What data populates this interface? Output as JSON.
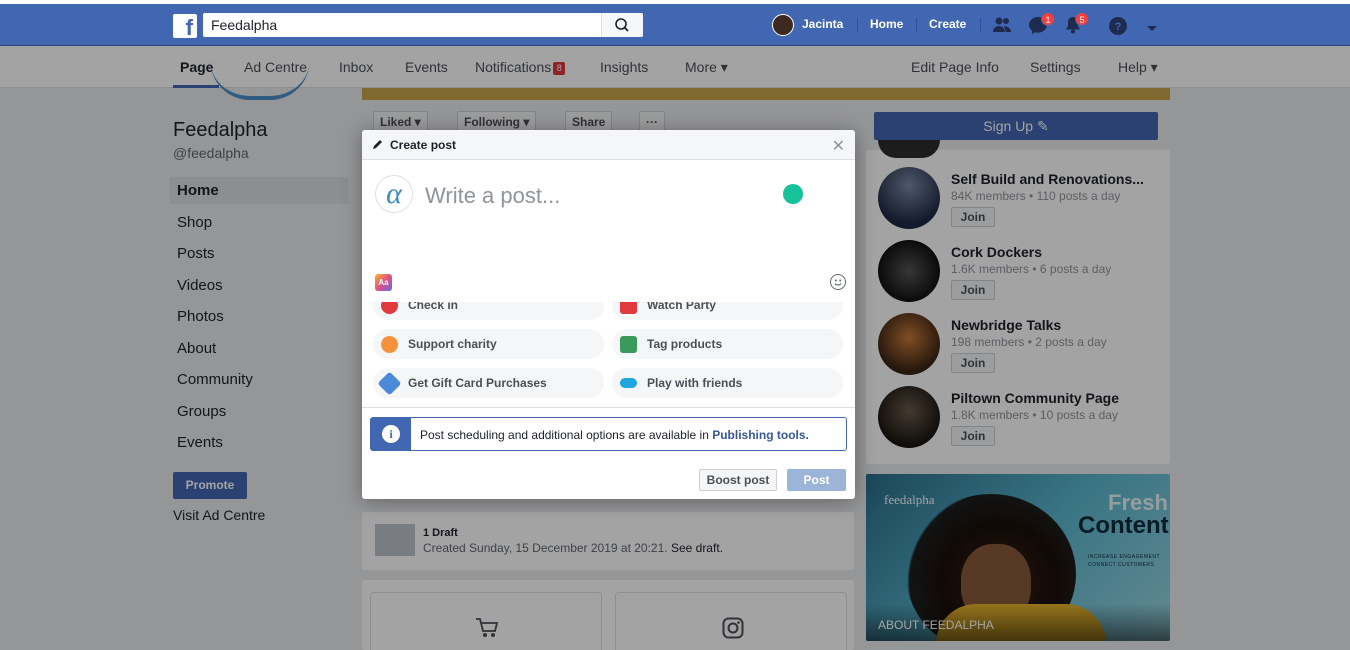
{
  "topbar": {
    "logo": "f",
    "search_value": "Feedalpha",
    "user_name": "Jacinta",
    "home_label": "Home",
    "create_label": "Create",
    "messenger_badge": "1",
    "notifications_badge": "5",
    "colors": {
      "bar": "#4267b2",
      "badge": "#fa3e3e"
    }
  },
  "pagenav": {
    "items": [
      {
        "label": "Page"
      },
      {
        "label": "Ad Centre"
      },
      {
        "label": "Inbox"
      },
      {
        "label": "Events"
      },
      {
        "label": "Notifications",
        "badge": "8"
      },
      {
        "label": "Insights"
      },
      {
        "label": "More ▾"
      }
    ],
    "right_items": [
      {
        "label": "Edit Page Info"
      },
      {
        "label": "Settings"
      },
      {
        "label": "Help ▾"
      }
    ]
  },
  "left": {
    "page_name": "Feedalpha",
    "handle": "@feedalpha",
    "items": [
      {
        "label": "Home"
      },
      {
        "label": "Shop"
      },
      {
        "label": "Posts"
      },
      {
        "label": "Videos"
      },
      {
        "label": "Photos"
      },
      {
        "label": "About"
      },
      {
        "label": "Community"
      },
      {
        "label": "Groups"
      },
      {
        "label": "Events"
      }
    ],
    "promote_label": "Promote",
    "visit_ad_centre": "Visit Ad Centre"
  },
  "center": {
    "actions": [
      "Liked ▾",
      "Following ▾",
      "Share",
      "···"
    ],
    "draft_title": "1 Draft",
    "draft_sub": "Created Sunday, 15 December 2019 at 20:21.",
    "draft_link": "See draft."
  },
  "right": {
    "signup_label": "Sign Up ✎",
    "groups": [
      {
        "name": "Self Build and Renovations...",
        "meta": "84K members • 110 posts a day",
        "join": "Join"
      },
      {
        "name": "Cork Dockers",
        "meta": "1.6K members • 6 posts a day",
        "join": "Join"
      },
      {
        "name": "Newbridge Talks",
        "meta": "198 members • 2 posts a day",
        "join": "Join"
      },
      {
        "name": "Piltown Community Page",
        "meta": "1.8K members • 10 posts a day",
        "join": "Join"
      }
    ],
    "promo": {
      "logo": "feedalpha",
      "fresh": "Fresh",
      "content": "Content",
      "small1": "INCREASE ENGAGEMENT",
      "small2": "CONNECT CUSTOMERS",
      "caption": "ABOUT FEEDALPHA"
    }
  },
  "modal": {
    "title": "Create post",
    "close_icon": "close-icon",
    "avatar_glyph": "α",
    "placeholder": "Write a post...",
    "textstyle_label": "Aa",
    "options": [
      {
        "label": "Check in",
        "icon": "checkin-icon",
        "color": "#e0393e"
      },
      {
        "label": "Watch Party",
        "icon": "watch-party-icon",
        "color": "#e0393e"
      },
      {
        "label": "Support charity",
        "icon": "charity-icon",
        "color": "#f7923a"
      },
      {
        "label": "Tag products",
        "icon": "tag-products-icon",
        "color": "#3a9a5b"
      },
      {
        "label": "Get Gift Card Purchases",
        "icon": "gift-card-icon",
        "color": "#4a8ad8"
      },
      {
        "label": "Play with friends",
        "icon": "game-controller-icon",
        "color": "#1fa6e0"
      }
    ],
    "info_text": "Post scheduling and additional options are available in",
    "info_link": "Publishing tools.",
    "boost_label": "Boost post",
    "post_label": "Post"
  }
}
